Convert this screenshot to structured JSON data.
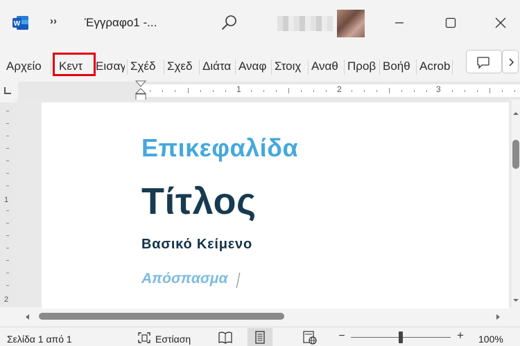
{
  "titlebar": {
    "doc_title": "Έγγραφο1  -...",
    "overflow_glyph": "››"
  },
  "ribbon": {
    "tabs": [
      {
        "label": "Αρχείο"
      },
      {
        "label": "Κεντ"
      },
      {
        "label": "Εισαγ"
      },
      {
        "label": "Σχέδ"
      },
      {
        "label": "Σχεδ"
      },
      {
        "label": "Διάτα"
      },
      {
        "label": "Αναφ"
      },
      {
        "label": "Στοιχ"
      },
      {
        "label": "Αναθ"
      },
      {
        "label": "Προβ"
      },
      {
        "label": "Βοήθ"
      },
      {
        "label": "Acrob"
      }
    ],
    "highlight_color": "#e0000a"
  },
  "ruler": {
    "numbers": [
      "1",
      "2",
      "3"
    ],
    "vertical_numbers": [
      "1",
      "2"
    ]
  },
  "document": {
    "heading": "Επικεφαλίδα",
    "title": "Τίτλος",
    "body": "Βασικό Κείμενο",
    "quote": "Απόσπασμα",
    "colors": {
      "heading": "#45a8dc",
      "title": "#173a50",
      "body": "#14334a",
      "quote": "#7dbbe0"
    }
  },
  "statusbar": {
    "page_info": "Σελίδα 1 από 1",
    "focus_label": "Εστίαση",
    "zoom_minus": "−",
    "zoom_plus": "+",
    "zoom_value": 100,
    "zoom_label": "100%"
  },
  "icons": {
    "app": "word-icon",
    "search": "search-icon",
    "comments": "comment-icon"
  }
}
